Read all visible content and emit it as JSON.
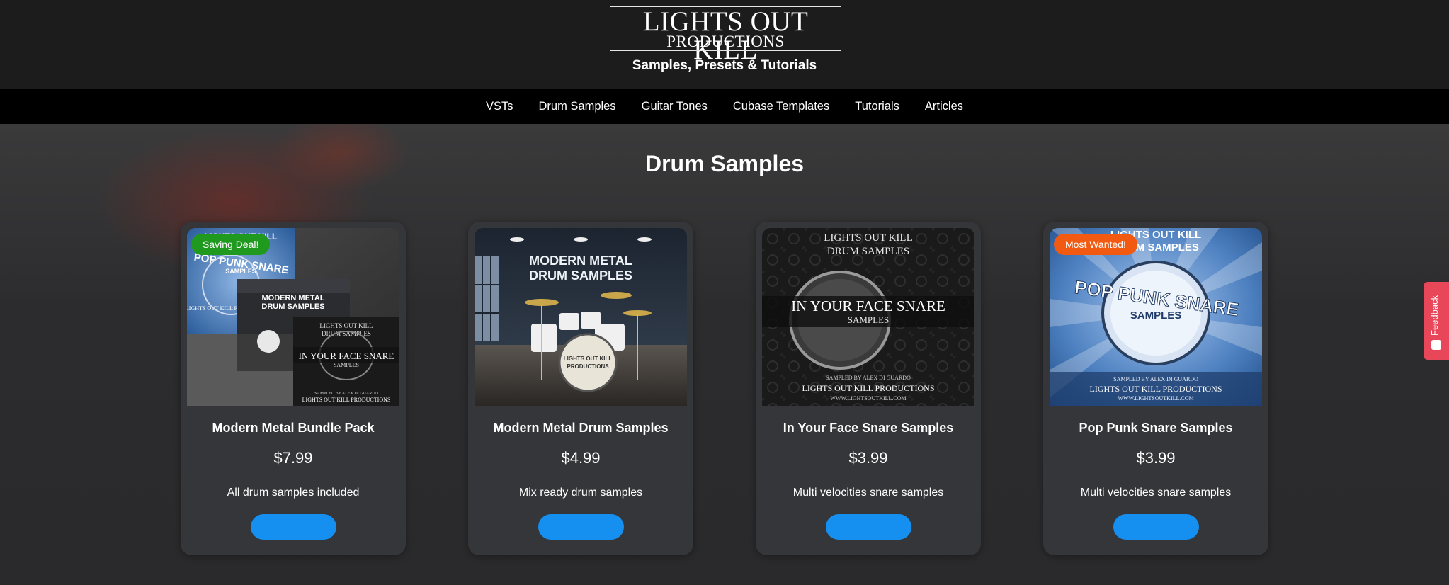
{
  "header": {
    "logo_line1": "LIGHTS OUT KILL",
    "logo_line2": "PRODUCTIONS",
    "tagline": "Samples, Presets & Tutorials"
  },
  "nav": {
    "items": [
      {
        "label": "VSTs"
      },
      {
        "label": "Drum Samples"
      },
      {
        "label": "Guitar Tones"
      },
      {
        "label": "Cubase Templates"
      },
      {
        "label": "Tutorials"
      },
      {
        "label": "Articles"
      }
    ]
  },
  "page": {
    "title": "Drum Samples"
  },
  "products": [
    {
      "badge": "Saving Deal!",
      "badge_color": "#1f9a1f",
      "name": "Modern Metal Bundle Pack",
      "price": "$7.99",
      "description": "All drum samples included"
    },
    {
      "name": "Modern Metal Drum Samples",
      "price": "$4.99",
      "description": "Mix ready drum samples"
    },
    {
      "name": "In Your Face Snare Samples",
      "price": "$3.99",
      "description": "Multi velocities snare samples"
    },
    {
      "badge": "Most Wanted!",
      "badge_color": "#f25a12",
      "name": "Pop Punk Snare Samples",
      "price": "$3.99",
      "description": "Multi velocities snare samples"
    }
  ],
  "artwork": {
    "bundle": {
      "pop_top": "LIGHTS OUT KILL",
      "pop_title": "POP PUNK SNARE",
      "pop_sub": "SAMPLES",
      "pop_footer": "LIGHTS OUT KILL PRO",
      "metal_title_1": "MODERN METAL",
      "metal_title_2": "DRUM SAMPLES",
      "iyf_top_1": "LIGHTS OUT KILL",
      "iyf_top_2": "DRUM SAMPLES",
      "iyf_title": "IN YOUR FACE SNARE",
      "iyf_sub": "SAMPLES",
      "iyf_credit": "SAMPLED BY ALEX DI GUARDO",
      "iyf_footer": "LIGHTS OUT KILL PRODUCTIONS"
    },
    "metal": {
      "title_1": "MODERN METAL",
      "title_2": "DRUM SAMPLES",
      "drum_1": "LIGHTS OUT KILL",
      "drum_2": "PRODUCTIONS"
    },
    "iyf": {
      "top_1": "LIGHTS OUT KILL",
      "top_2": "DRUM SAMPLES",
      "title": "IN YOUR FACE SNARE",
      "sub": "SAMPLES",
      "credit": "SAMPLED BY ALEX DI GUARDO",
      "footer": "LIGHTS OUT KILL PRODUCTIONS",
      "url": "WWW.LIGHTSOUTKILL.COM"
    },
    "pop": {
      "top_1": "LIGHTS OUT KILL",
      "top_2": "DRUM SAMPLES",
      "title": "POP PUNK SNARE",
      "sub": "SAMPLES",
      "credit": "SAMPLED BY ALEX DI GUARDO",
      "footer": "LIGHTS OUT KILL PRODUCTIONS",
      "url": "WWW.LIGHTSOUTKILL.COM"
    }
  },
  "feedback": {
    "label": "Feedback"
  }
}
